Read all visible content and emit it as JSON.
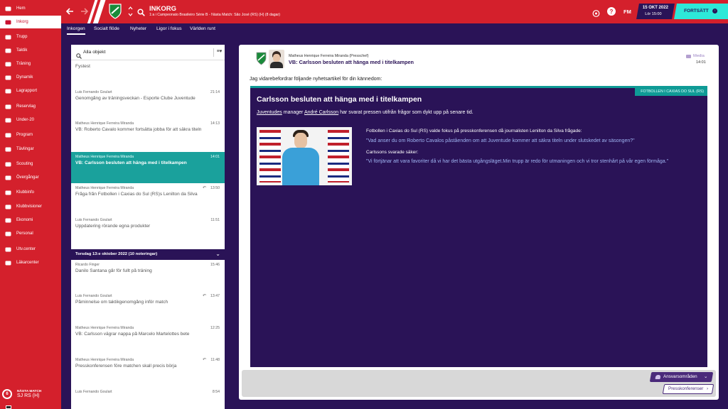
{
  "sidebar": {
    "items": [
      {
        "label": "Hem",
        "icon": "home-icon"
      },
      {
        "label": "Inkorg",
        "icon": "inbox-icon",
        "active": true
      },
      {
        "label": "Trupp",
        "icon": "squad-icon"
      },
      {
        "label": "Taktik",
        "icon": "tactics-icon"
      },
      {
        "label": "Träning",
        "icon": "training-icon"
      },
      {
        "label": "Dynamik",
        "icon": "dynamics-icon"
      },
      {
        "label": "Lagrapport",
        "icon": "report-icon"
      },
      {
        "label": "Reservlag",
        "icon": "reserves-icon"
      },
      {
        "label": "Under-20",
        "icon": "u20-icon"
      },
      {
        "label": "Program",
        "icon": "schedule-icon"
      },
      {
        "label": "Tävlingar",
        "icon": "trophy-icon"
      },
      {
        "label": "Scouting",
        "icon": "scouting-icon"
      },
      {
        "label": "Övergångar",
        "icon": "transfers-icon"
      },
      {
        "label": "Klubbinfo",
        "icon": "club-info-icon"
      },
      {
        "label": "Klubbvisioner",
        "icon": "vision-icon"
      },
      {
        "label": "Ekonomi",
        "icon": "finance-icon"
      },
      {
        "label": "Personal",
        "icon": "staff-icon"
      },
      {
        "label": "Utv.center",
        "icon": "dev-centre-icon"
      },
      {
        "label": "Läkarcenter",
        "icon": "medical-icon"
      }
    ],
    "next_match": {
      "label": "NÄSTA MATCH",
      "team": "SJ RS (H)",
      "number": "6"
    }
  },
  "topbar": {
    "title": "INKORG",
    "subtitle": "1:a i Campeonato Brasileiro Série B - Nästa Match: São José (RS) (H) (8 dagar)",
    "fm_label": "FM",
    "date": "15 OKT 2022",
    "day_time": "Lör 15:00",
    "continue_label": "FORTSÄTT",
    "colors": {
      "brand": "#d4202c",
      "accent": "#2ee8d8"
    }
  },
  "subnav": {
    "tabs": [
      "Inkorgen",
      "Socialt flöde",
      "Nyheter",
      "Ligor i fokus",
      "Världen runt"
    ]
  },
  "list": {
    "filter_label": "Alla objekt",
    "partial_top": "Fystest",
    "messages": [
      {
        "sender": "Luis Fernando Goulart",
        "time": "21:14",
        "subject": "Genomgång av träningsveckan - Esporte Clube Juventude"
      },
      {
        "sender": "Matheus Henrique Ferreira Miranda",
        "time": "14:13",
        "subject": "VB: Roberto Cavalo kommer fortsätta jobba för att säkra titeln"
      },
      {
        "sender": "Matheus Henrique Ferreira Miranda",
        "time": "14:01",
        "subject": "VB: Carlsson besluten att hänga med i titelkampen",
        "selected": true
      },
      {
        "sender": "Matheus Henrique Ferreira Miranda",
        "time": "13:50",
        "subject": "Fråga från Fotbollen i Caxias do Sul (RS)s Lenilton da Silva",
        "reply": true
      },
      {
        "sender": "Luis Fernando Goulart",
        "time": "11:51",
        "subject": "Uppdatering rörande egna produkter"
      }
    ],
    "group_header": "Torsdag 13:e oktober 2022 (10 noteringar)",
    "messages2": [
      {
        "sender": "Ricardo Finger",
        "time": "15:46",
        "subject": "Danilo Santana går för fullt på träning"
      },
      {
        "sender": "Luis Fernando Goulart",
        "time": "13:47",
        "subject": "Påminnelse om taktikgenomgång inför match",
        "reply": true
      },
      {
        "sender": "Matheus Henrique Ferreira Miranda",
        "time": "12:25",
        "subject": "VB: Carlsson vägrar nappa på Marcelo Martelottes bete"
      },
      {
        "sender": "Matheus Henrique Ferreira Miranda",
        "time": "11:48",
        "subject": "Presskonferensen före matchen skall precis börja",
        "reply": true
      },
      {
        "sender": "Luis Fernando Goulart",
        "time": "8:54",
        "subject": ""
      }
    ]
  },
  "message": {
    "sender": "Matheus Henrique Ferreira Miranda  (Presschef)",
    "title": "VB: Carlsson besluten att hänga med i titelkampen",
    "media_label": "Media",
    "time": "14:01",
    "intro": "Jag vidarebefordrar följande nyhetsartikel för din kännedom:",
    "article": {
      "source_tag": "FOTBOLLEN I CAXIAS DO SUL (RS)",
      "headline": "Carlsson besluten att hänga med i titelkampen",
      "lead_name1": "Juventudes",
      "lead_mid": " manager ",
      "lead_name2": "André Carlsson",
      "lead_rest": " har svarat pressen utifrån frågor som dykt upp på senare tid.",
      "p1": "Fotbollen i Caxias do Sul (RS) valde fokus på presskonferensen då journalisten Lenilton da Silva frågade:",
      "q1": "\"Vad anser du om Roberto Cavalos påståenden om att Juventude kommer att säkra titeln under slutskedet av säsongen?\"",
      "p2": "Carlssons svarade säker:",
      "q2": "\"Vi förtjänar att vara favoriter då vi har det bästa utgångsläget.Min trupp är redo för utmaningen och vi tror stenhårt på vår egen förmåga.\""
    }
  },
  "footer": {
    "responsibility_label": "Ansvarsområden",
    "press_label": "Presskonferenser"
  }
}
